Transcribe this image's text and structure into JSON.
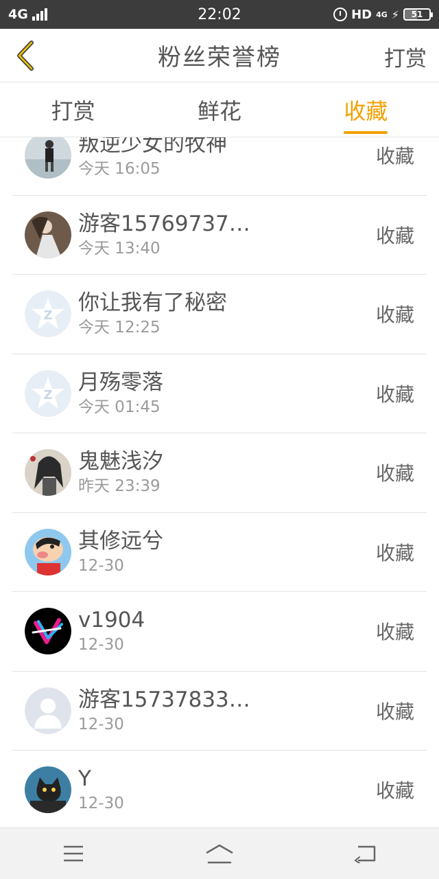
{
  "status_bar": {
    "network": "4G",
    "time": "22:02",
    "hd": "HD",
    "network_small": "4G",
    "battery": "51"
  },
  "header": {
    "back_icon": "chevron-left-icon",
    "title": "粉丝荣誉榜",
    "action_label": "打赏",
    "accent_color": "#f2a000"
  },
  "tabs": [
    {
      "label": "打赏",
      "active": false
    },
    {
      "label": "鲜花",
      "active": false
    },
    {
      "label": "收藏",
      "active": true
    }
  ],
  "list": [
    {
      "name": "叛逆少女的牧神",
      "time": "今天 16:05",
      "action": "收藏",
      "avatar": "photo-avatar"
    },
    {
      "name": "游客15769737…",
      "time": "今天 13:40",
      "action": "收藏",
      "avatar": "photo-avatar"
    },
    {
      "name": "你让我有了秘密",
      "time": "今天 12:25",
      "action": "收藏",
      "avatar": "default-star-avatar"
    },
    {
      "name": "月殇零落",
      "time": "今天 01:45",
      "action": "收藏",
      "avatar": "default-star-avatar"
    },
    {
      "name": "鬼魅浅汐",
      "time": "昨天 23:39",
      "action": "收藏",
      "avatar": "anime-avatar"
    },
    {
      "name": "其修远兮",
      "time": "12-30",
      "action": "收藏",
      "avatar": "cartoon-avatar"
    },
    {
      "name": "v1904",
      "time": "12-30",
      "action": "收藏",
      "avatar": "v-logo-avatar"
    },
    {
      "name": "游客15737833…",
      "time": "12-30",
      "action": "收藏",
      "avatar": "default-person-avatar"
    },
    {
      "name": "Y",
      "time": "12-30",
      "action": "收藏",
      "avatar": "cat-avatar"
    }
  ],
  "navbar": {
    "menu_icon": "menu-icon",
    "home_icon": "home-icon",
    "back_icon": "return-icon"
  }
}
